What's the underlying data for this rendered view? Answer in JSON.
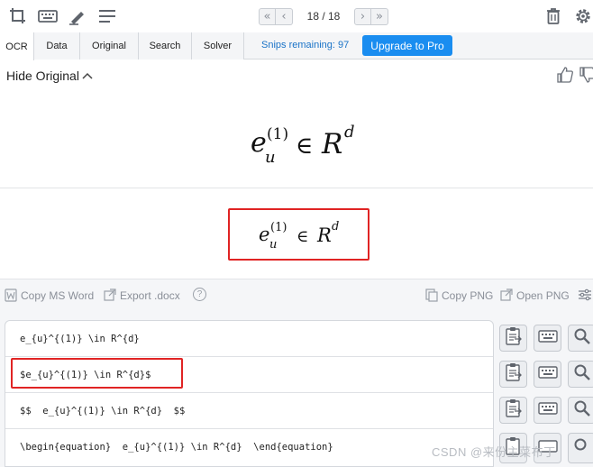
{
  "toolbar": {
    "icons": [
      "crop-icon",
      "keyboard-icon",
      "pen-icon",
      "menu-lines-icon"
    ],
    "pager": {
      "label": "18 / 18",
      "first_glyph": "«",
      "prev_glyph": "‹",
      "next_glyph": "›",
      "last_glyph": "»"
    },
    "right_icons": [
      "trash-icon",
      "gear-icon"
    ]
  },
  "tabs": [
    {
      "label": "OCR",
      "active": true
    },
    {
      "label": "Data",
      "active": false
    },
    {
      "label": "Original",
      "active": false
    },
    {
      "label": "Search",
      "active": false
    },
    {
      "label": "Solver",
      "active": false
    }
  ],
  "snips_remaining": "Snips remaining: 97",
  "upgrade_label": "Upgrade to Pro",
  "original": {
    "hide_label": "Hide Original",
    "chevron": "^"
  },
  "math": {
    "base": "e",
    "sub": "u",
    "sup": "(1)",
    "op": "∈",
    "set": "R",
    "set_sup": "d"
  },
  "actions": {
    "copy_word": "Copy MS Word",
    "export_docx": "Export .docx",
    "help": "?",
    "copy_png": "Copy PNG",
    "open_png": "Open PNG"
  },
  "results": [
    "e_{u}^{(1)} \\in R^{d}",
    "$e_{u}^{(1)} \\in R^{d}$",
    "$$  e_{u}^{(1)} \\in R^{d}  $$",
    "\\begin{equation}  e_{u}^{(1)} \\in R^{d}  \\end{equation}"
  ],
  "watermark": "CSDN @来份主菜布丁",
  "colors": {
    "accent_blue": "#1a8df0",
    "highlight_red": "#e02424",
    "icon_gray": "#6b7079"
  }
}
